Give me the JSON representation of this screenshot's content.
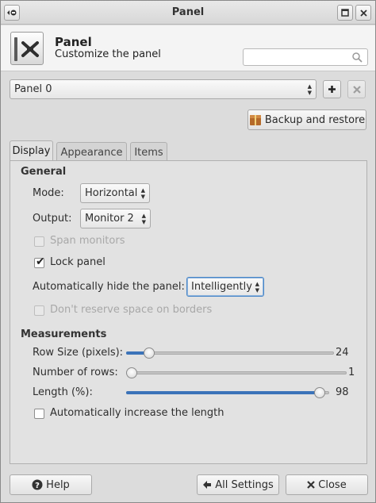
{
  "window": {
    "title": "Panel"
  },
  "header": {
    "title": "Panel",
    "subtitle": "Customize the panel",
    "search_placeholder": ""
  },
  "panel_selector": {
    "value": "Panel 0"
  },
  "backup_button": {
    "label": "Backup and restore"
  },
  "tabs": [
    {
      "label": "Display",
      "active": true
    },
    {
      "label": "Appearance",
      "active": false
    },
    {
      "label": "Items",
      "active": false
    }
  ],
  "general": {
    "heading": "General",
    "mode": {
      "label": "Mode:",
      "value": "Horizontal"
    },
    "output": {
      "label": "Output:",
      "value": "Monitor 2"
    },
    "span_monitors": {
      "label": "Span monitors",
      "checked": false,
      "enabled": false
    },
    "lock_panel": {
      "label": "Lock panel",
      "checked": true,
      "enabled": true
    },
    "autohide": {
      "label": "Automatically hide the panel:",
      "value": "Intelligently"
    },
    "reserve_space": {
      "label": "Don't reserve space on borders",
      "checked": false,
      "enabled": false
    }
  },
  "measurements": {
    "heading": "Measurements",
    "row_size": {
      "label": "Row Size (pixels):",
      "value": "24",
      "fraction": 0.09
    },
    "rows": {
      "label": "Number of rows:",
      "value": "1",
      "fraction": 0.0
    },
    "length": {
      "label": "Length (%):",
      "value": "98",
      "fraction": 0.98
    },
    "auto_length": {
      "label": "Automatically increase the length",
      "checked": false
    }
  },
  "footer": {
    "help_label": "Help",
    "all_settings_label": "All Settings",
    "close_label": "Close"
  },
  "colors": {
    "accent": "#3b73b9"
  }
}
